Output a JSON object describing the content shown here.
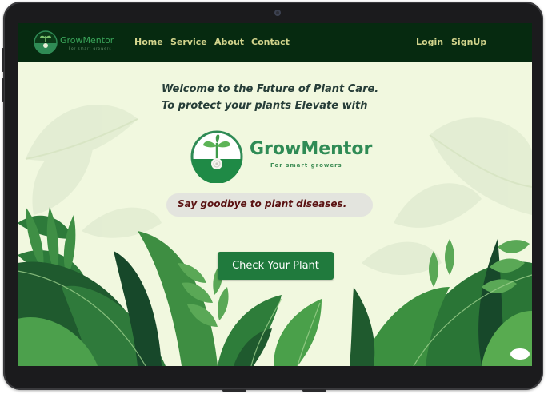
{
  "nav": {
    "logo_name": "GrowMentor",
    "logo_tagline": "For smart growers",
    "links": [
      "Home",
      "Service",
      "About",
      "Contact"
    ],
    "login": "Login",
    "signup": "SignUp"
  },
  "hero": {
    "headline_line1": "Welcome to the Future of Plant Care.",
    "headline_line2": "To protect your plants Elevate with",
    "brand_name": "GrowMentor",
    "brand_tagline": "For smart growers",
    "slogan": "Say goodbye to plant diseases.",
    "cta_label": "Check Your Plant"
  },
  "colors": {
    "navbar": "#062a10",
    "background": "#f1f8df",
    "nav_text": "#d2d48c",
    "brand_green": "#2f8b55",
    "cta": "#207a3d",
    "slogan_text": "#5a1212"
  }
}
